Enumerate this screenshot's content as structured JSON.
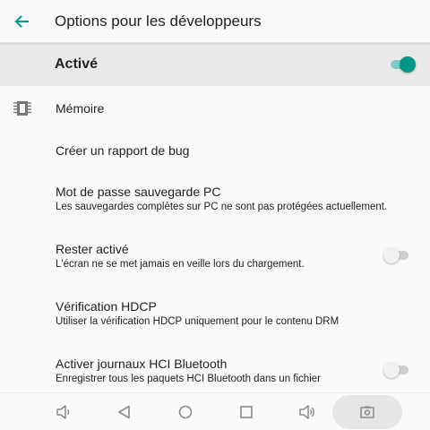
{
  "header": {
    "title": "Options pour les développeurs",
    "back_icon": "arrow-left-icon",
    "accent_color": "#009688"
  },
  "master_switch": {
    "label": "Activé",
    "state": true
  },
  "items": [
    {
      "title": "Mémoire",
      "summary": "",
      "icon": "memory-chip-icon"
    },
    {
      "title": "Créer un rapport de bug",
      "summary": ""
    },
    {
      "title": "Mot de passe sauvegarde PC",
      "summary": "Les sauvegardes complètes sur PC ne sont pas protégées actuellement."
    },
    {
      "title": "Rester activé",
      "summary": "L'écran ne se met jamais en veille lors du chargement.",
      "switch": false
    },
    {
      "title": "Vérification HDCP",
      "summary": "Utiliser la vérification HDCP uniquement pour le contenu DRM"
    },
    {
      "title": "Activer journaux HCI Bluetooth",
      "summary": "Enregistrer tous les paquets HCI Bluetooth dans un fichier",
      "switch": false
    }
  ],
  "navbar": {
    "buttons": [
      "volume-down-icon",
      "back-triangle-icon",
      "home-circle-icon",
      "recents-square-icon",
      "volume-up-icon",
      "screenshot-icon"
    ]
  }
}
